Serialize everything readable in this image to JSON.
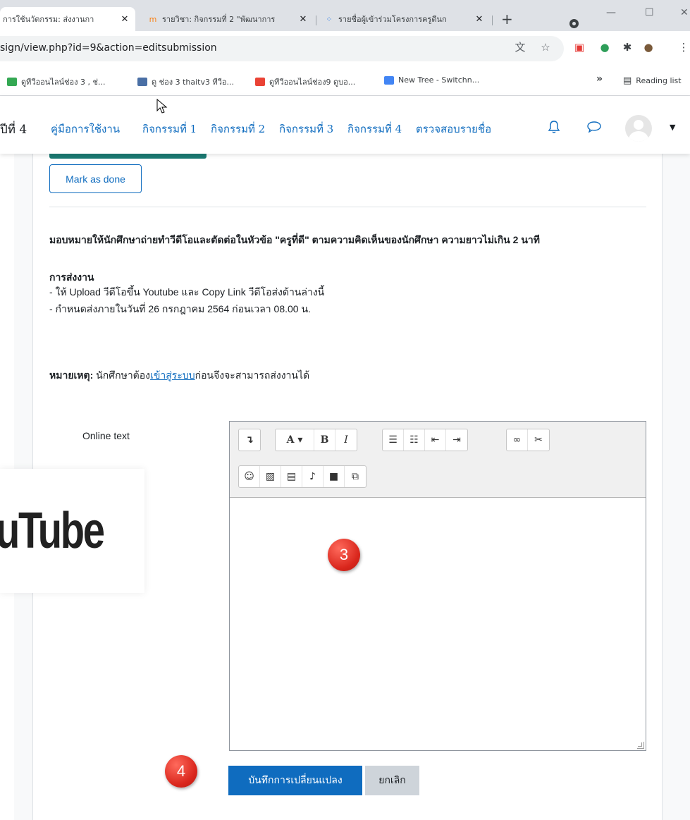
{
  "browser": {
    "tabs": [
      {
        "title": "การใช้นวัตกรรม: ส่งงานกา",
        "close": "✕",
        "active": true,
        "fav_color": "#f98012"
      },
      {
        "title": "รายวิชา: กิจกรรมที่ 2 \"พัฒนาการ",
        "close": "✕",
        "active": false,
        "fav_color": "#f98012"
      },
      {
        "title": "รายชื่อผู้เข้าร่วมโครงการครูดีนก",
        "close": "✕",
        "active": false,
        "fav_color": "#1a73e8"
      }
    ],
    "new_tab": "+",
    "url": "sign/view.php?id=9&action=editsubmission",
    "bookmarks": [
      {
        "label": "ดูทีวีออนไลน์ช่อง 3 , ช่...",
        "color": "#34a853"
      },
      {
        "label": "ดู ช่อง 3 thaitv3 ทีวีอ...",
        "color": "#4a6fa5"
      },
      {
        "label": "ดูทีวีออนไลน์ช่อง9 ดูบอ...",
        "color": "#ea4335"
      },
      {
        "label": "New Tree - Switchn...",
        "color": "#4285f4"
      }
    ],
    "bookmarks_more": "»",
    "reading_list": "Reading list"
  },
  "nav": {
    "lead": "ปีที่ 4",
    "links": [
      "คู่มือการใช้งาน",
      "กิจกรรมที่ 1",
      "กิจกรรมที่ 2",
      "กิจกรรมที่ 3",
      "กิจกรรมที่ 4",
      "ตรวจสอบรายชื่อ"
    ]
  },
  "page": {
    "mark_done": "Mark as done",
    "intro": "มอบหมายให้นักศึกษาถ่ายทำวีดีโอและตัดต่อในหัวข้อ \"ครูที่ดี\" ตามความคิดเห็นของนักศึกษา ความยาวไม่เกิน  2 นาที",
    "submission_heading": "การส่งงาน",
    "line1": "- ให้ Upload วีดีโอขึ้น Youtube และ Copy Link วีดีโอส่งด้านล่างนี้",
    "line2": "- กำหนดส่งภายในวันที่ 26 กรกฎาคม 2564 ก่อนเวลา 08.00 น.",
    "note_label": "หมายเหตุ:",
    "note_pre": " นักศึกษาต้อง",
    "note_link": "เข้าสู่ระบบ",
    "note_post": "ก่อนจึงจะสามารถส่งงานได้",
    "field_label": "Online text"
  },
  "buttons": {
    "save": "บันทึกการเปลี่ยนแปลง",
    "cancel": "ยกเลิก"
  },
  "overlay": {
    "logo_text": "uTube",
    "marker3": "3",
    "marker4": "4"
  },
  "colors": {
    "accent": "#0f6cbf",
    "marker": "#d9261c"
  }
}
